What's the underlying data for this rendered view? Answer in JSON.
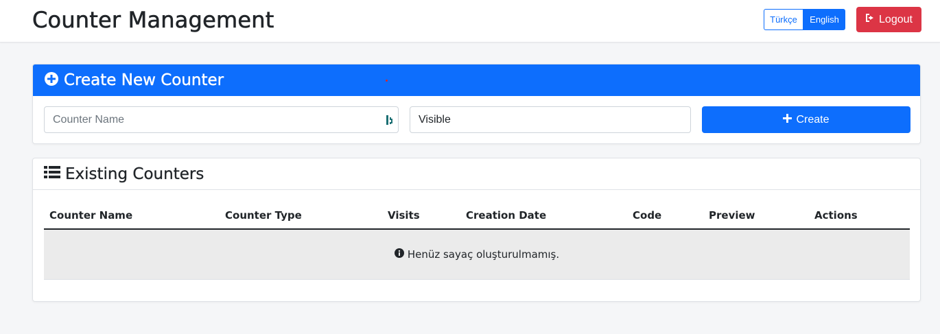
{
  "header": {
    "title": "Counter Management",
    "lang_tr": "Türkçe",
    "lang_en": "English",
    "active_language": "English",
    "logout_label": "Logout"
  },
  "create_card": {
    "title": "Create New Counter",
    "name_placeholder": "Counter Name",
    "name_value": "",
    "type_selected": "Visible",
    "create_label": "Create"
  },
  "list_card": {
    "title": "Existing Counters",
    "columns": [
      "Counter Name",
      "Counter Type",
      "Visits",
      "Creation Date",
      "Code",
      "Preview",
      "Actions"
    ],
    "empty_message": "Henüz sayaç oluşturulmamış."
  },
  "colors": {
    "primary": "#0d6efd",
    "danger": "#dc3545",
    "background": "#f5f6f8",
    "empty_row": "#ebebeb"
  },
  "icons": {
    "logout": "sign-out-icon",
    "create_header": "plus-circle-icon",
    "create_button": "plus-icon",
    "list_header": "list-icon",
    "empty": "info-circle-icon",
    "password_manager": "password-manager-icon"
  }
}
